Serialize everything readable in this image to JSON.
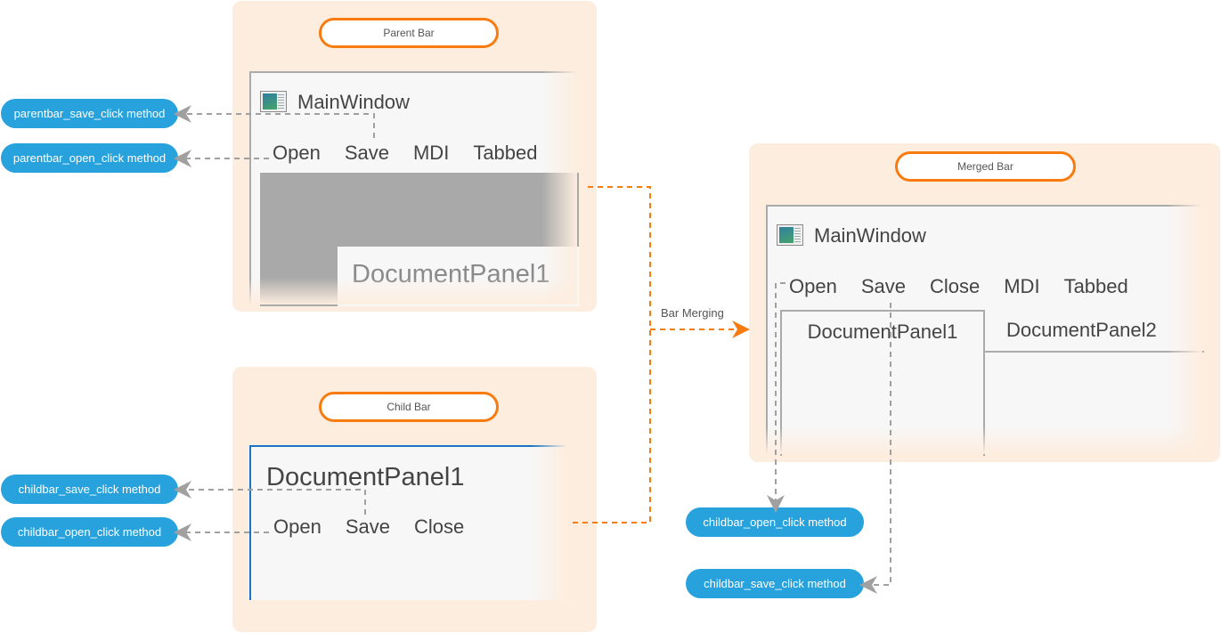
{
  "parent_bar": {
    "label": "Parent Bar",
    "window_title": "MainWindow",
    "icon": "app-window-icon",
    "menu": [
      "Open",
      "Save",
      "MDI",
      "Tabbed"
    ],
    "document_tab": "DocumentPanel1"
  },
  "child_bar": {
    "label": "Child Bar",
    "document_title": "DocumentPanel1",
    "menu": [
      "Open",
      "Save",
      "Close"
    ]
  },
  "merged_bar": {
    "label": "Merged Bar",
    "window_title": "MainWindow",
    "icon": "app-window-icon",
    "menu": [
      "Open",
      "Save",
      "Close",
      "MDI",
      "Tabbed"
    ],
    "tabs": [
      "DocumentPanel1",
      "DocumentPanel2"
    ],
    "active_tab": "DocumentPanel1"
  },
  "connector": {
    "label": "Bar Merging"
  },
  "methods": {
    "parentbar_save": "parentbar_save_click method",
    "parentbar_open": "parentbar_open_click method",
    "childbar_save_left": "childbar_save_click method",
    "childbar_open_left": "childbar_open_click method",
    "childbar_open_right": "childbar_open_click method",
    "childbar_save_right": "childbar_save_click method"
  },
  "colors": {
    "panel_background": "#fdeddf",
    "accent_orange": "#f77b0f",
    "method_blue": "#27a2dc",
    "child_window_border": "#1873c5",
    "dashed_gray": "#a0a0a0"
  }
}
